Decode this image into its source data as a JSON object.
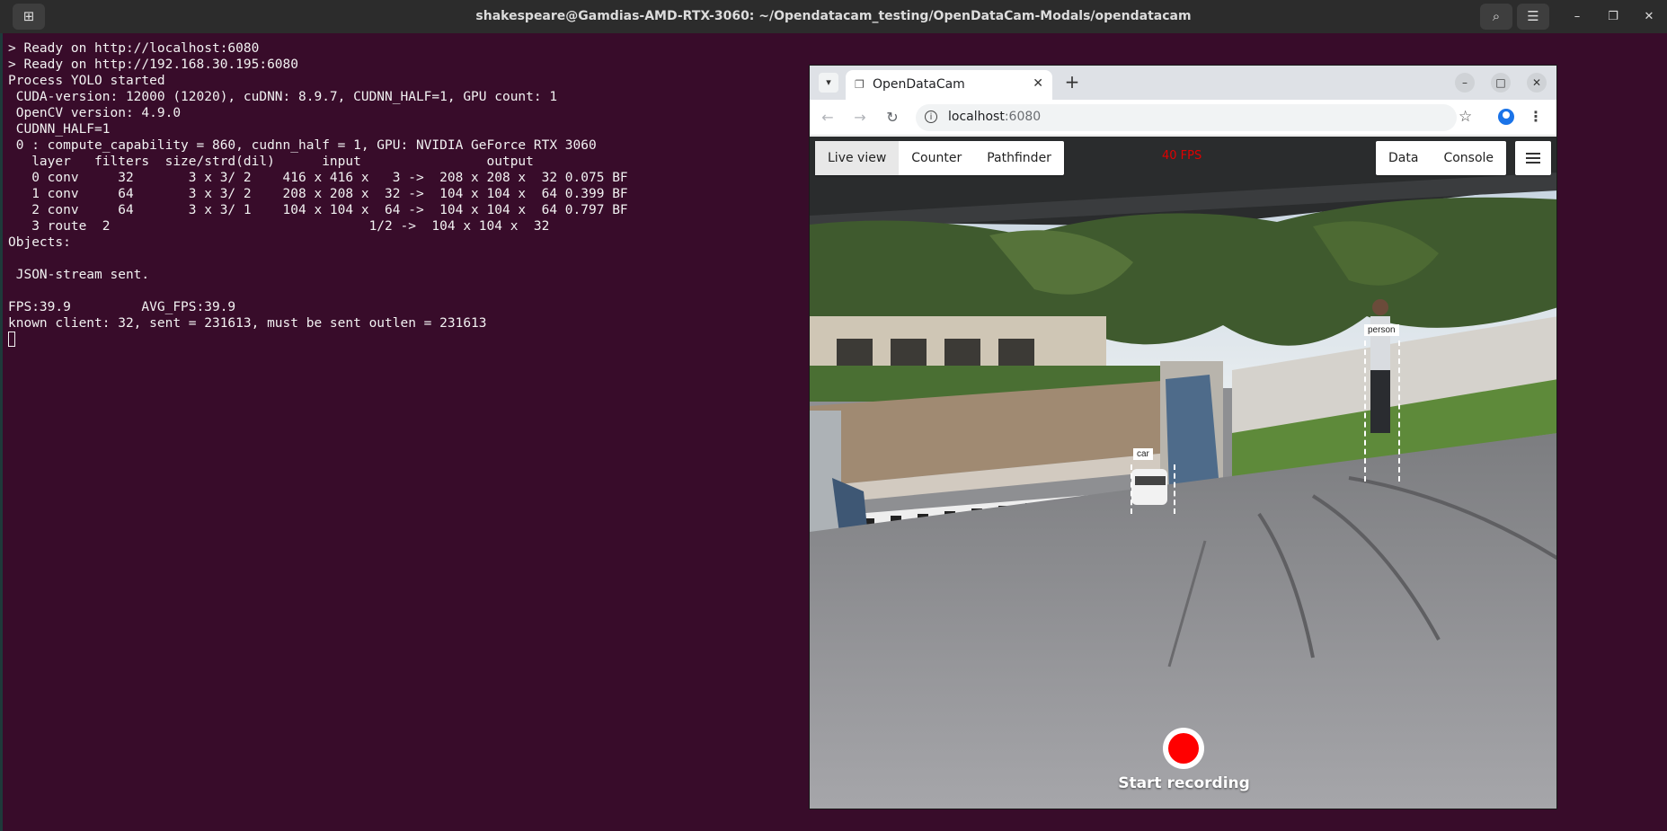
{
  "window": {
    "title": "shakespeare@Gamdias-AMD-RTX-3060: ~/Opendatacam_testing/OpenDataCam-Modals/opendatacam"
  },
  "terminal": {
    "lines": [
      "> Ready on http://localhost:6080",
      "> Ready on http://192.168.30.195:6080",
      "Process YOLO started",
      " CUDA-version: 12000 (12020), cuDNN: 8.9.7, CUDNN_HALF=1, GPU count: 1",
      " OpenCV version: 4.9.0",
      " CUDNN_HALF=1",
      " 0 : compute_capability = 860, cudnn_half = 1, GPU: NVIDIA GeForce RTX 3060",
      "   layer   filters  size/strd(dil)      input                output",
      "   0 conv     32       3 x 3/ 2    416 x 416 x   3 ->  208 x 208 x  32 0.075 BF",
      "   1 conv     64       3 x 3/ 2    208 x 208 x  32 ->  104 x 104 x  64 0.399 BF",
      "   2 conv     64       3 x 3/ 1    104 x 104 x  64 ->  104 x 104 x  64 0.797 BF",
      "   3 route  2                                 1/2 ->  104 x 104 x  32",
      "Objects:",
      "",
      " JSON-stream sent.",
      "",
      "FPS:39.9         AVG_FPS:39.9",
      "known client: 32, sent = 231613, must be sent outlen = 231613"
    ]
  },
  "browser": {
    "tab_title": "OpenDataCam",
    "url_host": "localhost",
    "url_port": ":6080"
  },
  "app": {
    "nav_left": [
      "Live view",
      "Counter",
      "Pathfinder"
    ],
    "nav_right": [
      "Data",
      "Console"
    ],
    "fps": "40 FPS",
    "detections": [
      "person",
      "car"
    ],
    "record_label": "Start recording"
  },
  "colors": {
    "terminal_bg": "#380c2a",
    "fps_red": "#e00000",
    "record_red": "#ff0000"
  }
}
